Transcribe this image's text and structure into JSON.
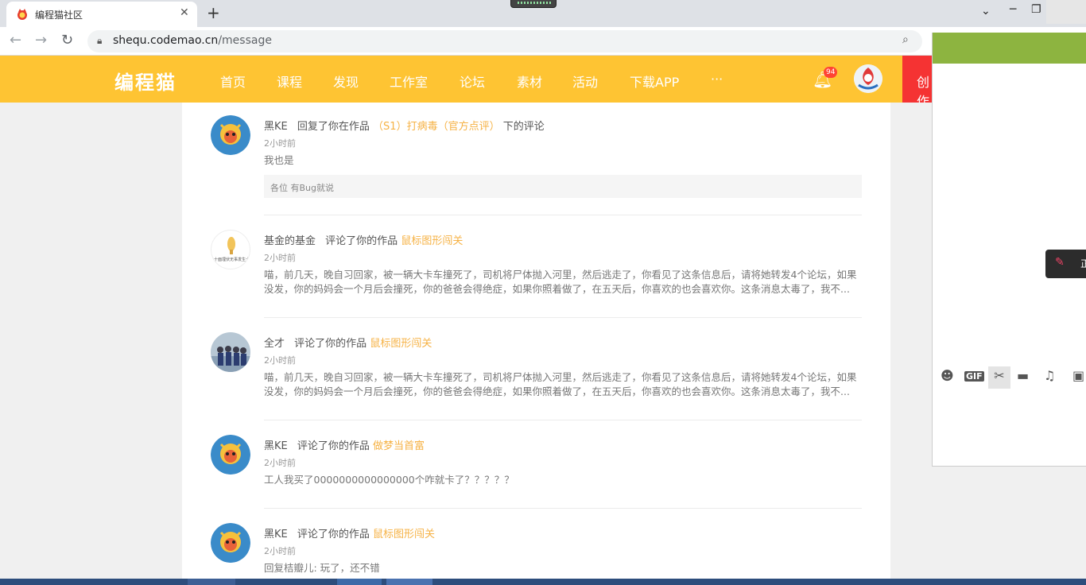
{
  "browser": {
    "tab_title": "编程猫社区",
    "tab_close": "✕",
    "new_tab": "+",
    "url_host": "shequ.codemao.cn",
    "url_path": "/message",
    "minimize": "─",
    "restore": "❐",
    "chevron": "⌄"
  },
  "header": {
    "logo": "编程猫",
    "nav": [
      "首页",
      "课程",
      "发现",
      "工作室",
      "论坛",
      "素材",
      "活动",
      "下载APP",
      "···"
    ],
    "badge": "94",
    "create_label": "创作"
  },
  "messages": [
    {
      "user": "黑KE",
      "action": "回复了你在作品",
      "work": "（S1）打病毒（官方点评）",
      "suffix": "下的评论",
      "time": "2小时前",
      "body": "我也是",
      "quote": "各位 有Bug就说"
    },
    {
      "user": "基金的基金",
      "action": "评论了你的作品",
      "work": "鼠标图形闯关",
      "time": "2小时前",
      "body": "喵，前几天，晚自习回家，被一辆大卡车撞死了，司机将尸体抛入河里，然后逃走了，你看见了这条信息后，请将她转发4个论坛，如果没发，你的妈妈会一个月后会撞死，你的爸爸会得绝症，如果你照着做了，在五天后，你喜欢的也会喜欢你。这条消息太毒了，我不..."
    },
    {
      "user": "全才",
      "action": "评论了你的作品",
      "work": "鼠标图形闯关",
      "time": "2小时前",
      "body": "喵，前几天，晚自习回家，被一辆大卡车撞死了，司机将尸体抛入河里，然后逃走了，你看见了这条信息后，请将她转发4个论坛，如果没发，你的妈妈会一个月后会撞死，你的爸爸会得绝症，如果你照着做了，在五天后，你喜欢的也会喜欢你。这条消息太毒了，我不..."
    },
    {
      "user": "黑KE",
      "action": "评论了你的作品",
      "work": "做梦当首富",
      "time": "2小时前",
      "body": "工人我买了0000000000000000个咋就卡了？？？？？"
    },
    {
      "user": "黑KE",
      "action": "评论了你的作品",
      "work": "鼠标图形闯关",
      "time": "2小时前",
      "body": "回复桔瓣儿:  玩了，还不错"
    }
  ],
  "avatar2_caption": "十面埋伏无事发生十",
  "chat": {
    "tools": [
      "smile-icon",
      "gif-icon",
      "scissors-icon",
      "folder-icon",
      "music-icon",
      "image-icon"
    ],
    "gif_label": "GIF",
    "mute_text": "正"
  },
  "colors": {
    "header": "#fec433",
    "work_link": "#f6b245",
    "create": "#f53333",
    "chat_top": "#8db440"
  }
}
